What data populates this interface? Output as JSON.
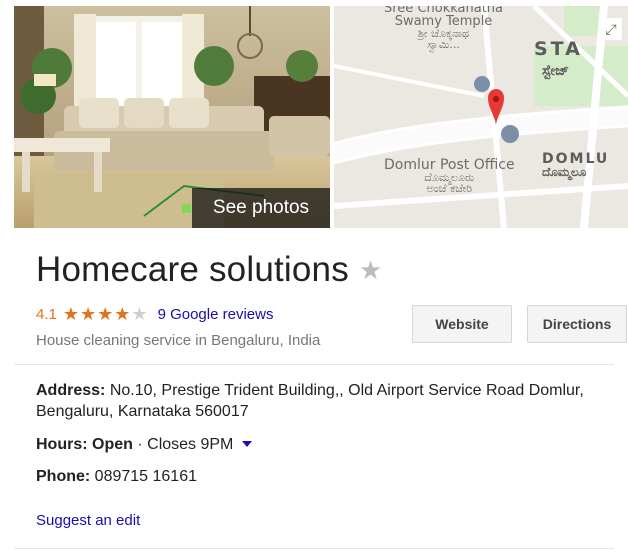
{
  "photo": {
    "button_label": "See photos"
  },
  "map": {
    "temple_line1": "Sree Chokkanatha",
    "temple_line2": "Swamy Temple",
    "temple_kn1": "ಶ್ರೀ ಚೊಕ್ಕನಾಥ",
    "temple_kn2": "ಸ್ವಾಮಿ...",
    "area_en": "STA",
    "area_kn": "ಸ್ಟೇಜ್",
    "post_office": "Domlur Post Office",
    "post_office_kn1": "ದೊಮ್ಮಲೂರು",
    "post_office_kn2": "ಅಂಚೆ ಕಚೇರಿ",
    "domlur_en": "DOMLU",
    "domlur_kn": "ದೊಮ್ಮಲೂ",
    "road_color": "#ffffff",
    "park_color": "#c8e6c9",
    "pin_color": "#e53935"
  },
  "business": {
    "name": "Homecare solutions",
    "rating": "4.1",
    "rating_value": 4.1,
    "reviews_label": "9 Google reviews",
    "category": "House cleaning service in Bengaluru, India"
  },
  "actions": {
    "website": "Website",
    "directions": "Directions"
  },
  "details": {
    "address_label": "Address:",
    "address_value": "No.10, Prestige Trident Building,, Old Airport Service Road Domlur, Bengaluru, Karnataka 560017",
    "hours_label": "Hours:",
    "hours_status": "Open",
    "hours_value": "· Closes 9PM",
    "phone_label": "Phone:",
    "phone_value": "089715 16161"
  },
  "suggest_edit": "Suggest an edit",
  "colors": {
    "link": "#1a0dab",
    "rating": "#e7711b",
    "muted": "#777777"
  }
}
